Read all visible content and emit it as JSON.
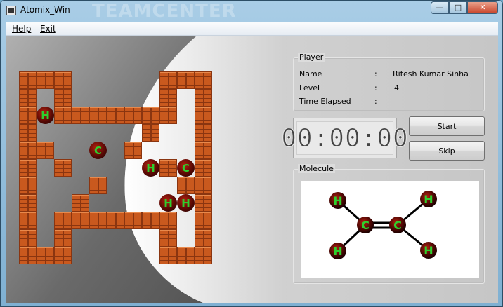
{
  "window": {
    "title": "Atomix_Win",
    "watermark": "TEAMCENTER",
    "minimize_glyph": "—",
    "maximize_glyph": "□",
    "close_glyph": "✕"
  },
  "menu": {
    "items": [
      {
        "label": "Help"
      },
      {
        "label": "Exit"
      }
    ]
  },
  "player": {
    "group_label": "Player",
    "name_label": "Name",
    "name_value": "Ritesh Kumar Sinha",
    "level_label": "Level",
    "level_value": "4",
    "time_label": "Time Elapsed",
    "time_value": "",
    "colon": ":"
  },
  "timer": {
    "display": "00:00:00"
  },
  "buttons": {
    "start_label": "Start",
    "skip_label": "Skip"
  },
  "molecule": {
    "group_label": "Molecule",
    "atoms": [
      {
        "symbol": "H"
      },
      {
        "symbol": "H"
      },
      {
        "symbol": "C"
      },
      {
        "symbol": "C"
      },
      {
        "symbol": "H"
      },
      {
        "symbol": "H"
      }
    ]
  },
  "board": {
    "atoms": [
      {
        "symbol": "H"
      },
      {
        "symbol": "C"
      },
      {
        "symbol": "H"
      },
      {
        "symbol": "C"
      },
      {
        "symbol": "H"
      },
      {
        "symbol": "H"
      }
    ]
  },
  "colors": {
    "brick": "#c9591e",
    "atom_text": "#2ed02e",
    "atom_body": "#8a1208"
  }
}
